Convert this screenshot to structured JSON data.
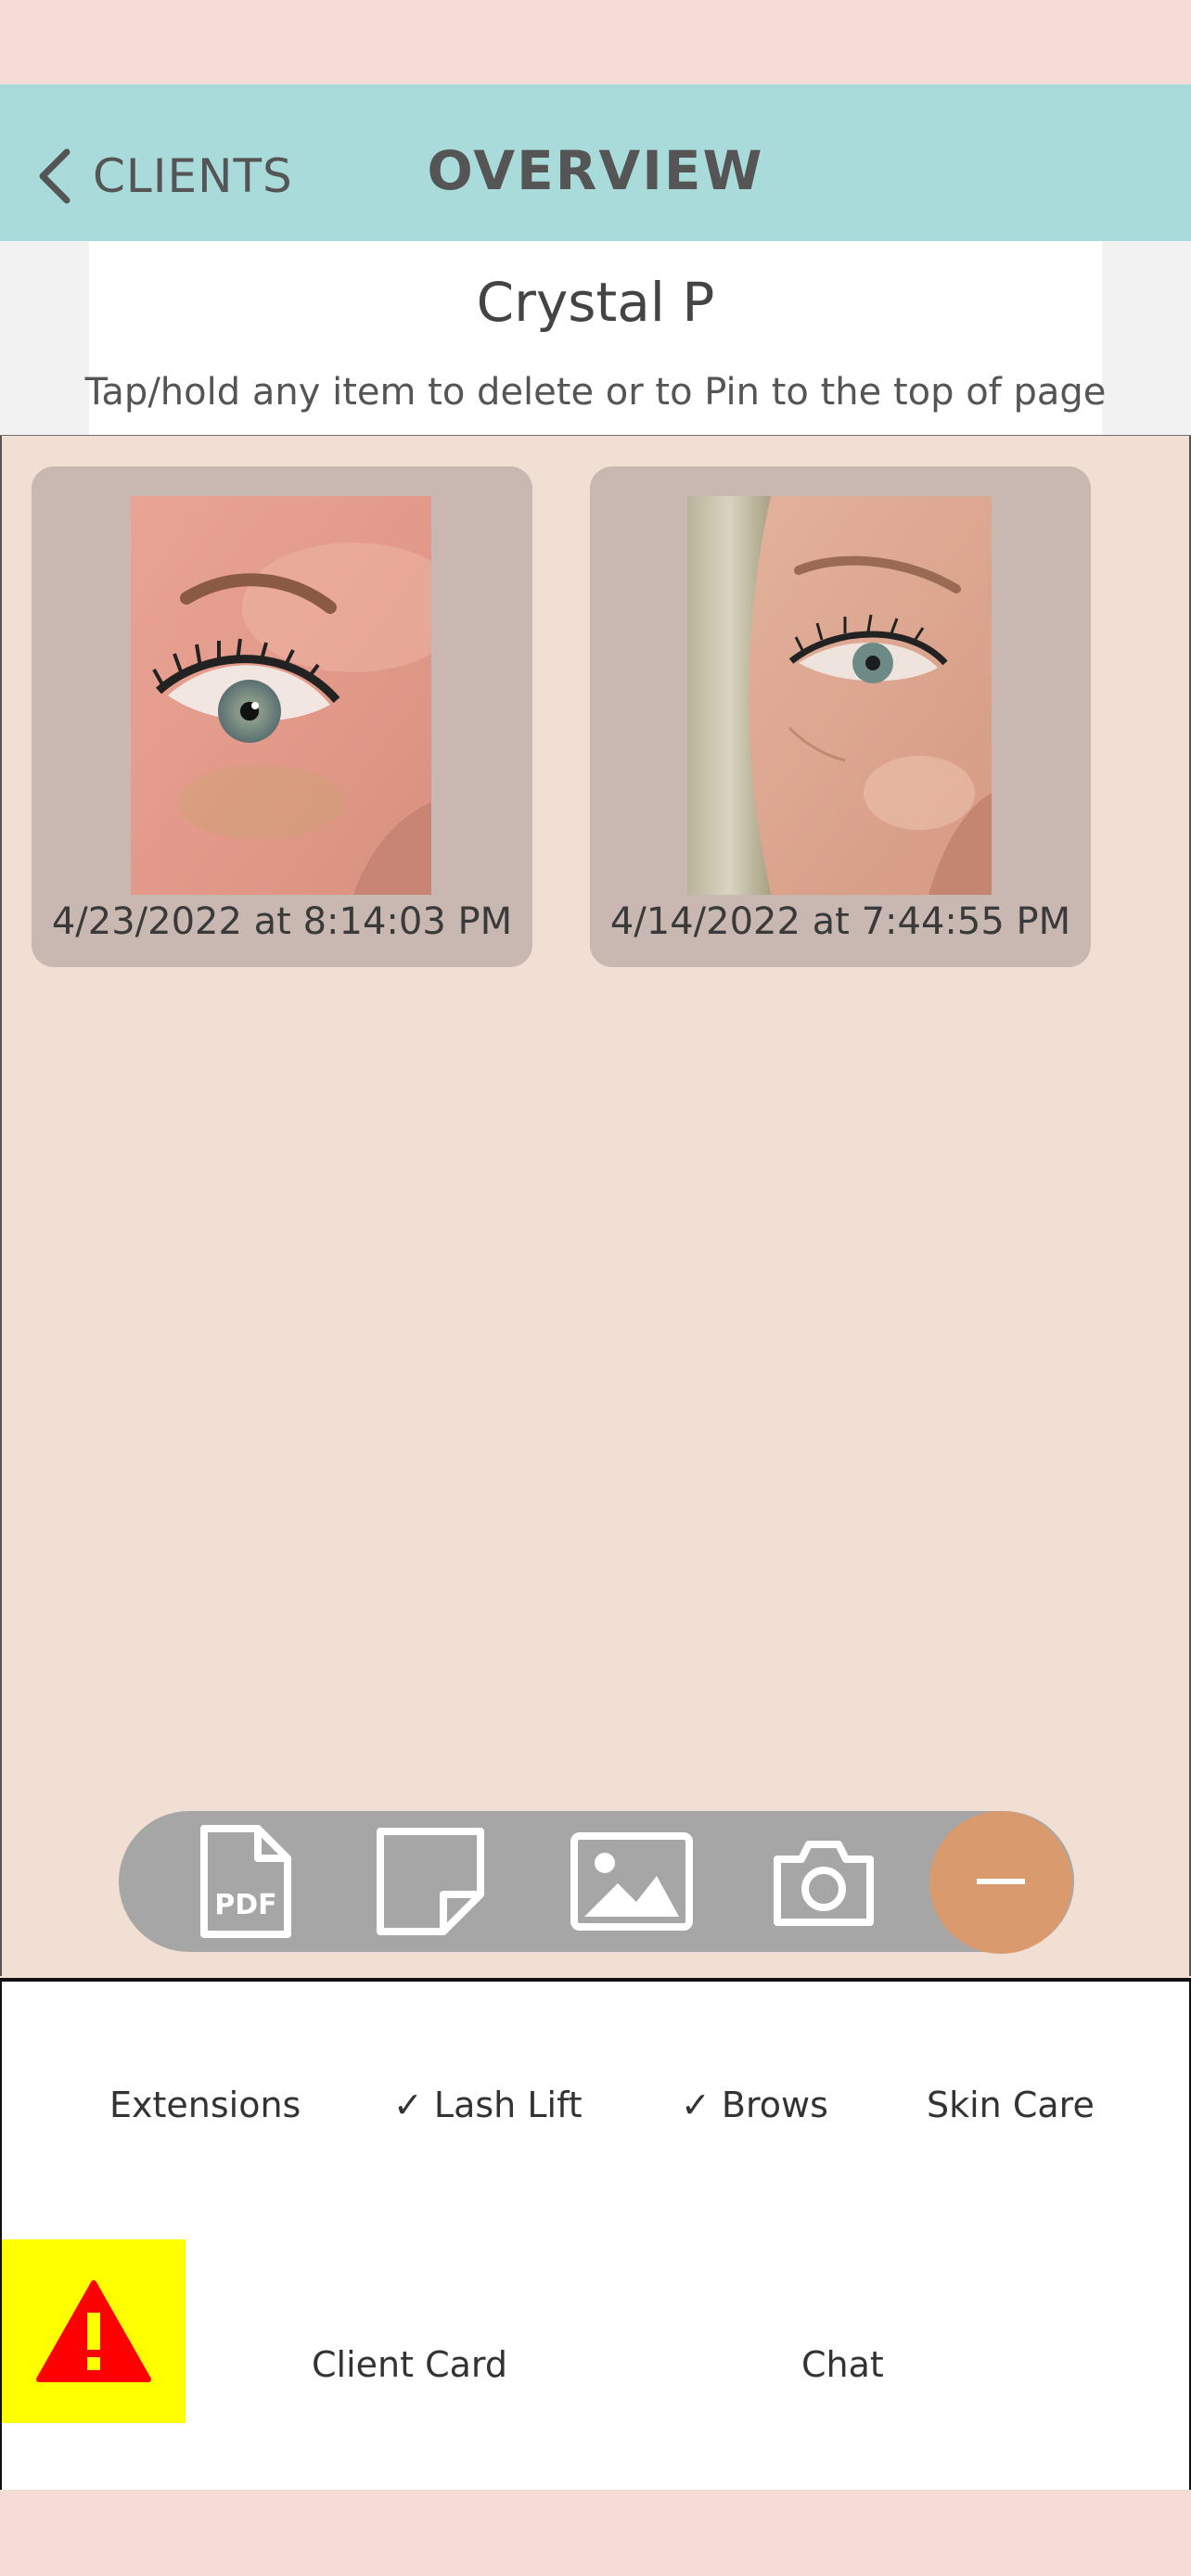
{
  "header": {
    "back_label": "CLIENTS",
    "title": "OVERVIEW"
  },
  "client": {
    "name": "Crystal P",
    "hint": "Tap/hold any item to delete or to Pin to the top of page"
  },
  "photos": [
    {
      "timestamp": "4/23/2022 at 8:14:03 PM"
    },
    {
      "timestamp": "4/14/2022 at 7:44:55 PM"
    }
  ],
  "toolbar": {
    "items": [
      {
        "icon": "pdf-icon",
        "label": "PDF"
      },
      {
        "icon": "note-icon"
      },
      {
        "icon": "image-icon"
      },
      {
        "icon": "camera-icon"
      },
      {
        "icon": "minus-icon"
      }
    ]
  },
  "services": [
    {
      "label": "Extensions",
      "checked": false
    },
    {
      "label": "✓ Lash Lift",
      "checked": true
    },
    {
      "label": "✓ Brows",
      "checked": true
    },
    {
      "label": "Skin Care",
      "checked": false
    }
  ],
  "bottom_nav": {
    "alert_icon": "warning-icon",
    "client_card": "Client Card",
    "chat": "Chat"
  },
  "colors": {
    "header": "#a9dbdb",
    "page": "#f6dcd6",
    "content": "#f0dfd2",
    "card": "#c9b8b1",
    "toolbar": "#a6a6a6",
    "fab": "#d99a6e",
    "alert_bg": "#ffff00",
    "alert_icon": "#ff0000"
  }
}
